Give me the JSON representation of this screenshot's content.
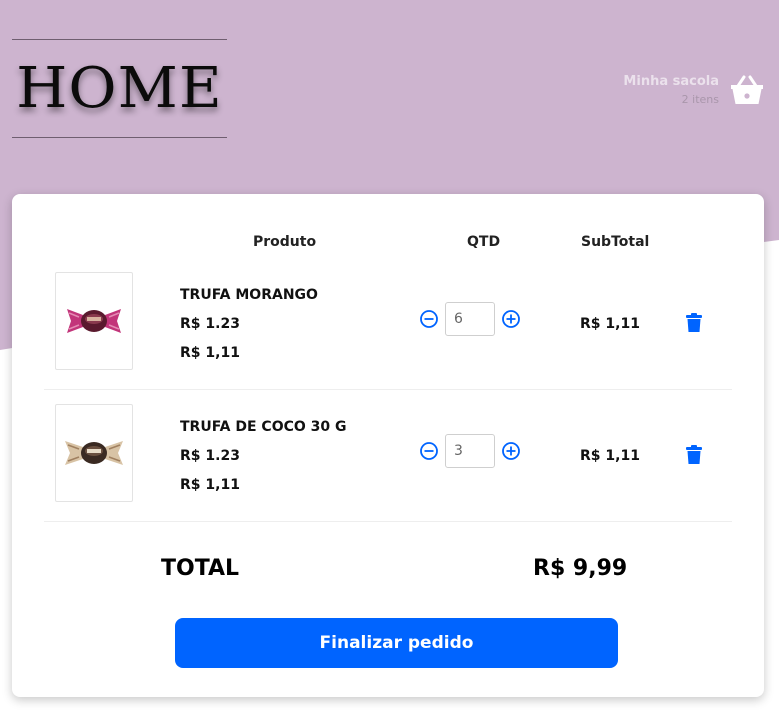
{
  "brand": {
    "logo_text": "HOME"
  },
  "cart_widget": {
    "title": "Minha sacola",
    "count": "2 itens",
    "icon": "basket-icon"
  },
  "table": {
    "headers": {
      "product": "Produto",
      "qty": "QTD",
      "subtotal": "SubTotal"
    },
    "items": [
      {
        "name": "TRUFA MORANGO",
        "price": "R$ 1.23",
        "price2": "R$ 1,11",
        "qty": "6",
        "subtotal": "R$ 1,11",
        "image": "truffle-pink-wrapper"
      },
      {
        "name": "TRUFA DE COCO 30 G",
        "price": "R$ 1.23",
        "price2": "R$ 1,11",
        "qty": "3",
        "subtotal": "R$ 1,11",
        "image": "truffle-gold-wrapper"
      }
    ]
  },
  "summary": {
    "total_label": "TOTAL",
    "total_value": "R$ 9,99"
  },
  "actions": {
    "finalize_label": "Finalizar pedido"
  },
  "colors": {
    "header_bg": "#cdb4cf",
    "accent": "#0064ff"
  }
}
